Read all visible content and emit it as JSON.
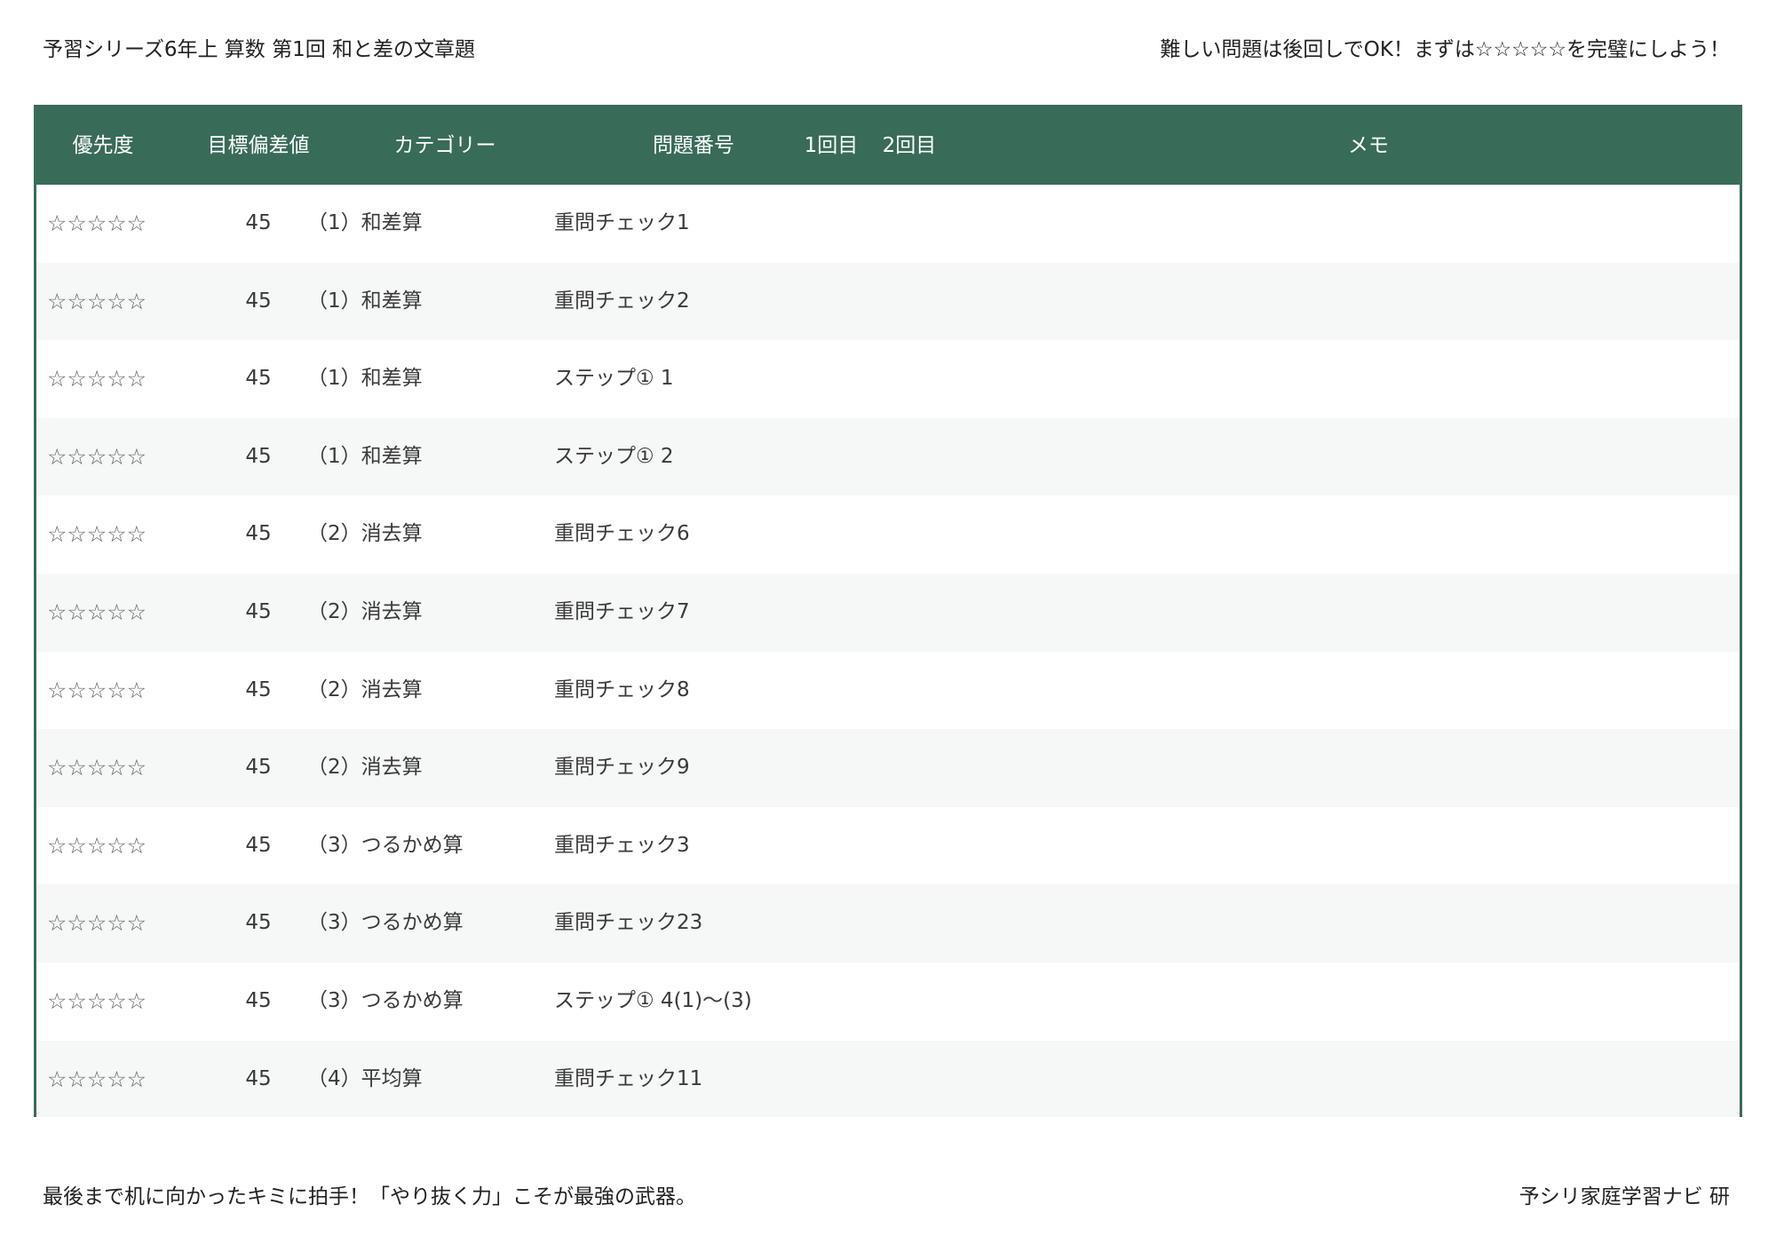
{
  "header": {
    "title": "予習シリーズ6年上 算数 第1回 和と差の文章題",
    "tip": "難しい問題は後回しでOK！まずは☆☆☆☆☆を完璧にしよう！"
  },
  "table": {
    "columns": {
      "priority": "優先度",
      "target_deviation": "目標偏差値",
      "category": "カテゴリー",
      "problem_number": "問題番号",
      "first": "1回目",
      "second": "2回目",
      "memo": "メモ"
    },
    "rows": [
      {
        "priority": "☆☆☆☆☆",
        "deviation": "45",
        "category": "（1）和差算",
        "problem": "重問チェック1"
      },
      {
        "priority": "☆☆☆☆☆",
        "deviation": "45",
        "category": "（1）和差算",
        "problem": "重問チェック2"
      },
      {
        "priority": "☆☆☆☆☆",
        "deviation": "45",
        "category": "（1）和差算",
        "problem": "ステップ① 1"
      },
      {
        "priority": "☆☆☆☆☆",
        "deviation": "45",
        "category": "（1）和差算",
        "problem": "ステップ① 2"
      },
      {
        "priority": "☆☆☆☆☆",
        "deviation": "45",
        "category": "（2）消去算",
        "problem": "重問チェック6"
      },
      {
        "priority": "☆☆☆☆☆",
        "deviation": "45",
        "category": "（2）消去算",
        "problem": "重問チェック7"
      },
      {
        "priority": "☆☆☆☆☆",
        "deviation": "45",
        "category": "（2）消去算",
        "problem": "重問チェック8"
      },
      {
        "priority": "☆☆☆☆☆",
        "deviation": "45",
        "category": "（2）消去算",
        "problem": "重問チェック9"
      },
      {
        "priority": "☆☆☆☆☆",
        "deviation": "45",
        "category": "（3）つるかめ算",
        "problem": "重問チェック3"
      },
      {
        "priority": "☆☆☆☆☆",
        "deviation": "45",
        "category": "（3）つるかめ算",
        "problem": "重問チェック23"
      },
      {
        "priority": "☆☆☆☆☆",
        "deviation": "45",
        "category": "（3）つるかめ算",
        "problem": "ステップ① 4(1)〜(3)"
      },
      {
        "priority": "☆☆☆☆☆",
        "deviation": "45",
        "category": "（4）平均算",
        "problem": "重問チェック11"
      }
    ]
  },
  "footer": {
    "message": "最後まで机に向かったキミに拍手！「やり抜く力」こそが最強の武器。",
    "credit": "予シリ家庭学習ナビ 研"
  },
  "colors": {
    "header_bg": "#386b58",
    "row_alt_bg": "#f5f8f6"
  }
}
